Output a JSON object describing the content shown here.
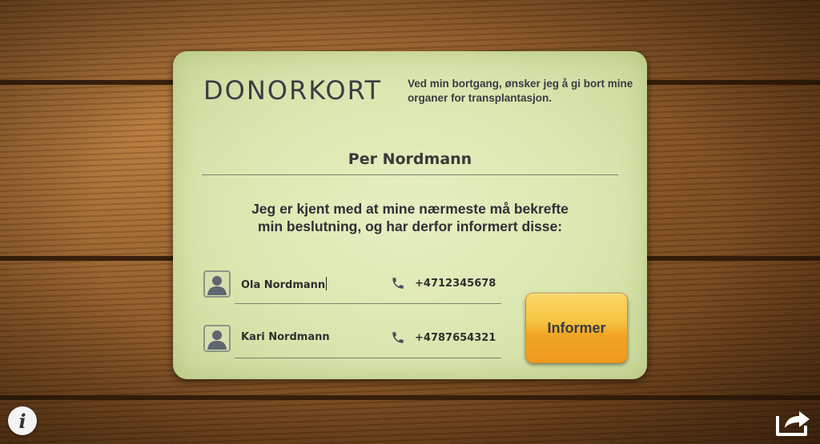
{
  "card": {
    "title": "DONORKORT",
    "subtitle": "Ved min bortgang, ønsker jeg å gi bort mine organer for transplantasjon.",
    "owner_name": "Per Nordmann",
    "statement_line1": "Jeg er kjent med at mine nærmeste må bekrefte",
    "statement_line2": "min beslutning, og har derfor informert disse:",
    "contacts": [
      {
        "name": "Ola Nordmann",
        "phone": "+4712345678"
      },
      {
        "name": "Kari Nordmann",
        "phone": "+4787654321"
      }
    ],
    "inform_button_label": "Informer"
  },
  "footer": {
    "info_label": "i",
    "info_icon": "info-icon",
    "share_icon": "share-icon"
  },
  "colors": {
    "card_bg": "#dbe7b0",
    "button_orange": "#f1a526",
    "text_dark": "#3a3a40"
  }
}
